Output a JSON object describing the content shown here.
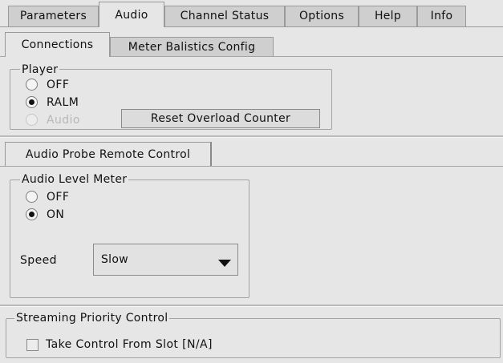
{
  "tabs": [
    {
      "label": "Parameters"
    },
    {
      "label": "Audio"
    },
    {
      "label": "Channel Status"
    },
    {
      "label": "Options"
    },
    {
      "label": "Help"
    },
    {
      "label": "Info"
    }
  ],
  "subtabs": {
    "connections": "Connections",
    "meter": "Meter Balistics Config"
  },
  "player": {
    "legend": "Player",
    "options": [
      {
        "label": "OFF",
        "selected": false,
        "enabled": true
      },
      {
        "label": "RALM",
        "selected": true,
        "enabled": true
      },
      {
        "label": "Audio",
        "selected": false,
        "enabled": false
      }
    ],
    "reset_button": "Reset Overload Counter"
  },
  "probe_tab": "Audio Probe Remote Control",
  "meter": {
    "legend": "Audio Level Meter",
    "options": [
      {
        "label": "OFF",
        "selected": false
      },
      {
        "label": "ON",
        "selected": true
      }
    ],
    "speed_label": "Speed",
    "speed_value": "Slow"
  },
  "streaming": {
    "legend": "Streaming Priority Control",
    "checkbox_label": "Take Control From Slot [N/A]",
    "checked": false
  },
  "colors": {
    "background": "#e6e6e6",
    "tab_inactive": "#cfcfcf"
  }
}
